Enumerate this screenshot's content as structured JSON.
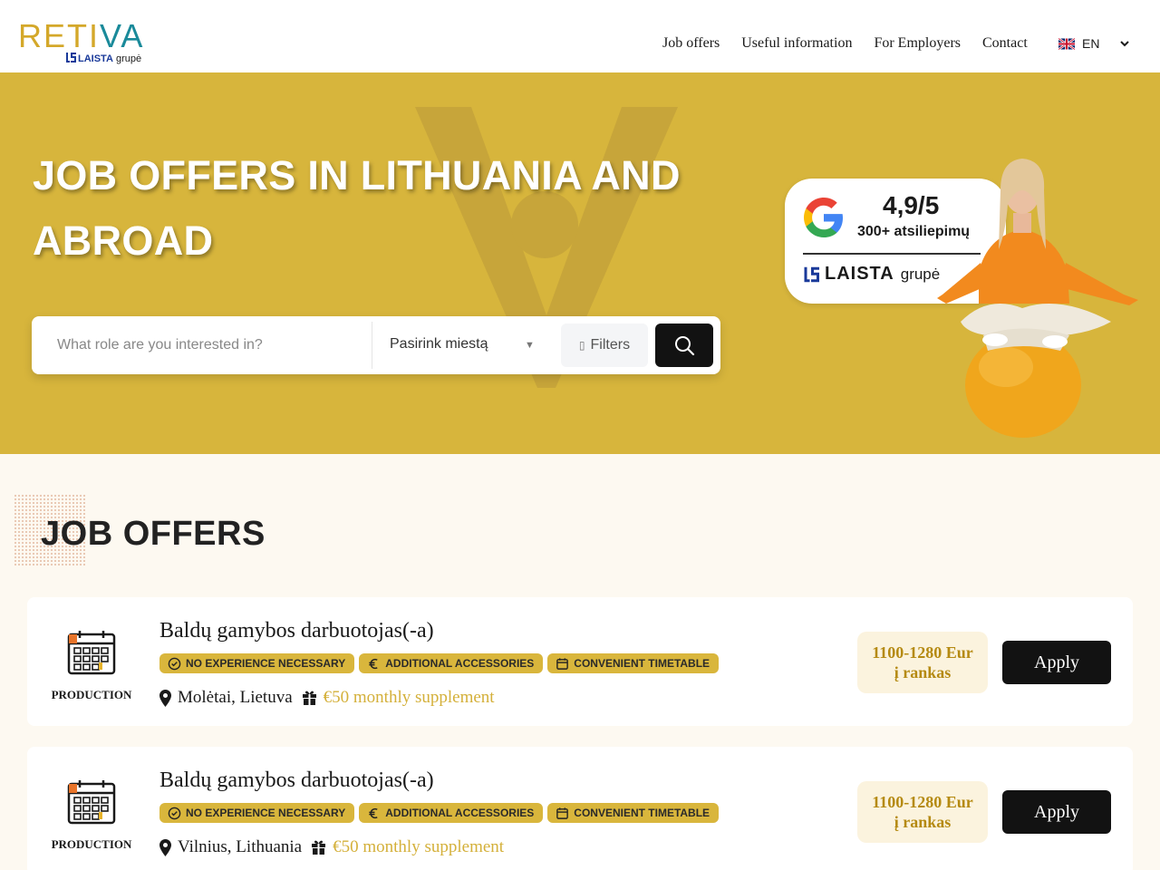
{
  "header": {
    "logo": {
      "text": "RETIVA",
      "sub_brand": "LAISTA",
      "sub_suffix": "grupė"
    },
    "nav": [
      "Job offers",
      "Useful information",
      "For Employers",
      "Contact"
    ],
    "language": "EN",
    "icons": {
      "flag": "uk-flag-icon",
      "chevron": "chevron-down-icon"
    }
  },
  "hero": {
    "title": "JOB OFFERS IN LITHUANIA AND ABROAD",
    "search": {
      "placeholder": "What role are you interested in?",
      "city_placeholder": "Pasirink miestą",
      "filters_label": "Filters"
    },
    "review": {
      "rating": "4,9/5",
      "count": "300+ atsiliepimų",
      "brand": "LAISTA",
      "brand_suffix": "grupė"
    },
    "colors": {
      "background": "#d7b53c"
    }
  },
  "section": {
    "title": "JOB OFFERS"
  },
  "jobs": [
    {
      "category": "PRODUCTION",
      "title": "Baldų gamybos darbuotojas(-a)",
      "tags": [
        "NO EXPERIENCE NECESSARY",
        "ADDITIONAL ACCESSORIES",
        "CONVENIENT TIMETABLE"
      ],
      "location": "Molėtai, Lietuva",
      "supplement": "€50 monthly supplement",
      "salary": "1100-1280 Eur į rankas",
      "apply_label": "Apply"
    },
    {
      "category": "PRODUCTION",
      "title": "Baldų gamybos darbuotojas(-a)",
      "tags": [
        "NO EXPERIENCE NECESSARY",
        "ADDITIONAL ACCESSORIES",
        "CONVENIENT TIMETABLE"
      ],
      "location": "Vilnius, Lithuania",
      "supplement": "€50 monthly supplement",
      "salary": "1100-1280 Eur į rankas",
      "apply_label": "Apply"
    }
  ],
  "colors": {
    "accent": "#d9b63c",
    "dark": "#121212",
    "page_bg": "#fdf9f1"
  }
}
